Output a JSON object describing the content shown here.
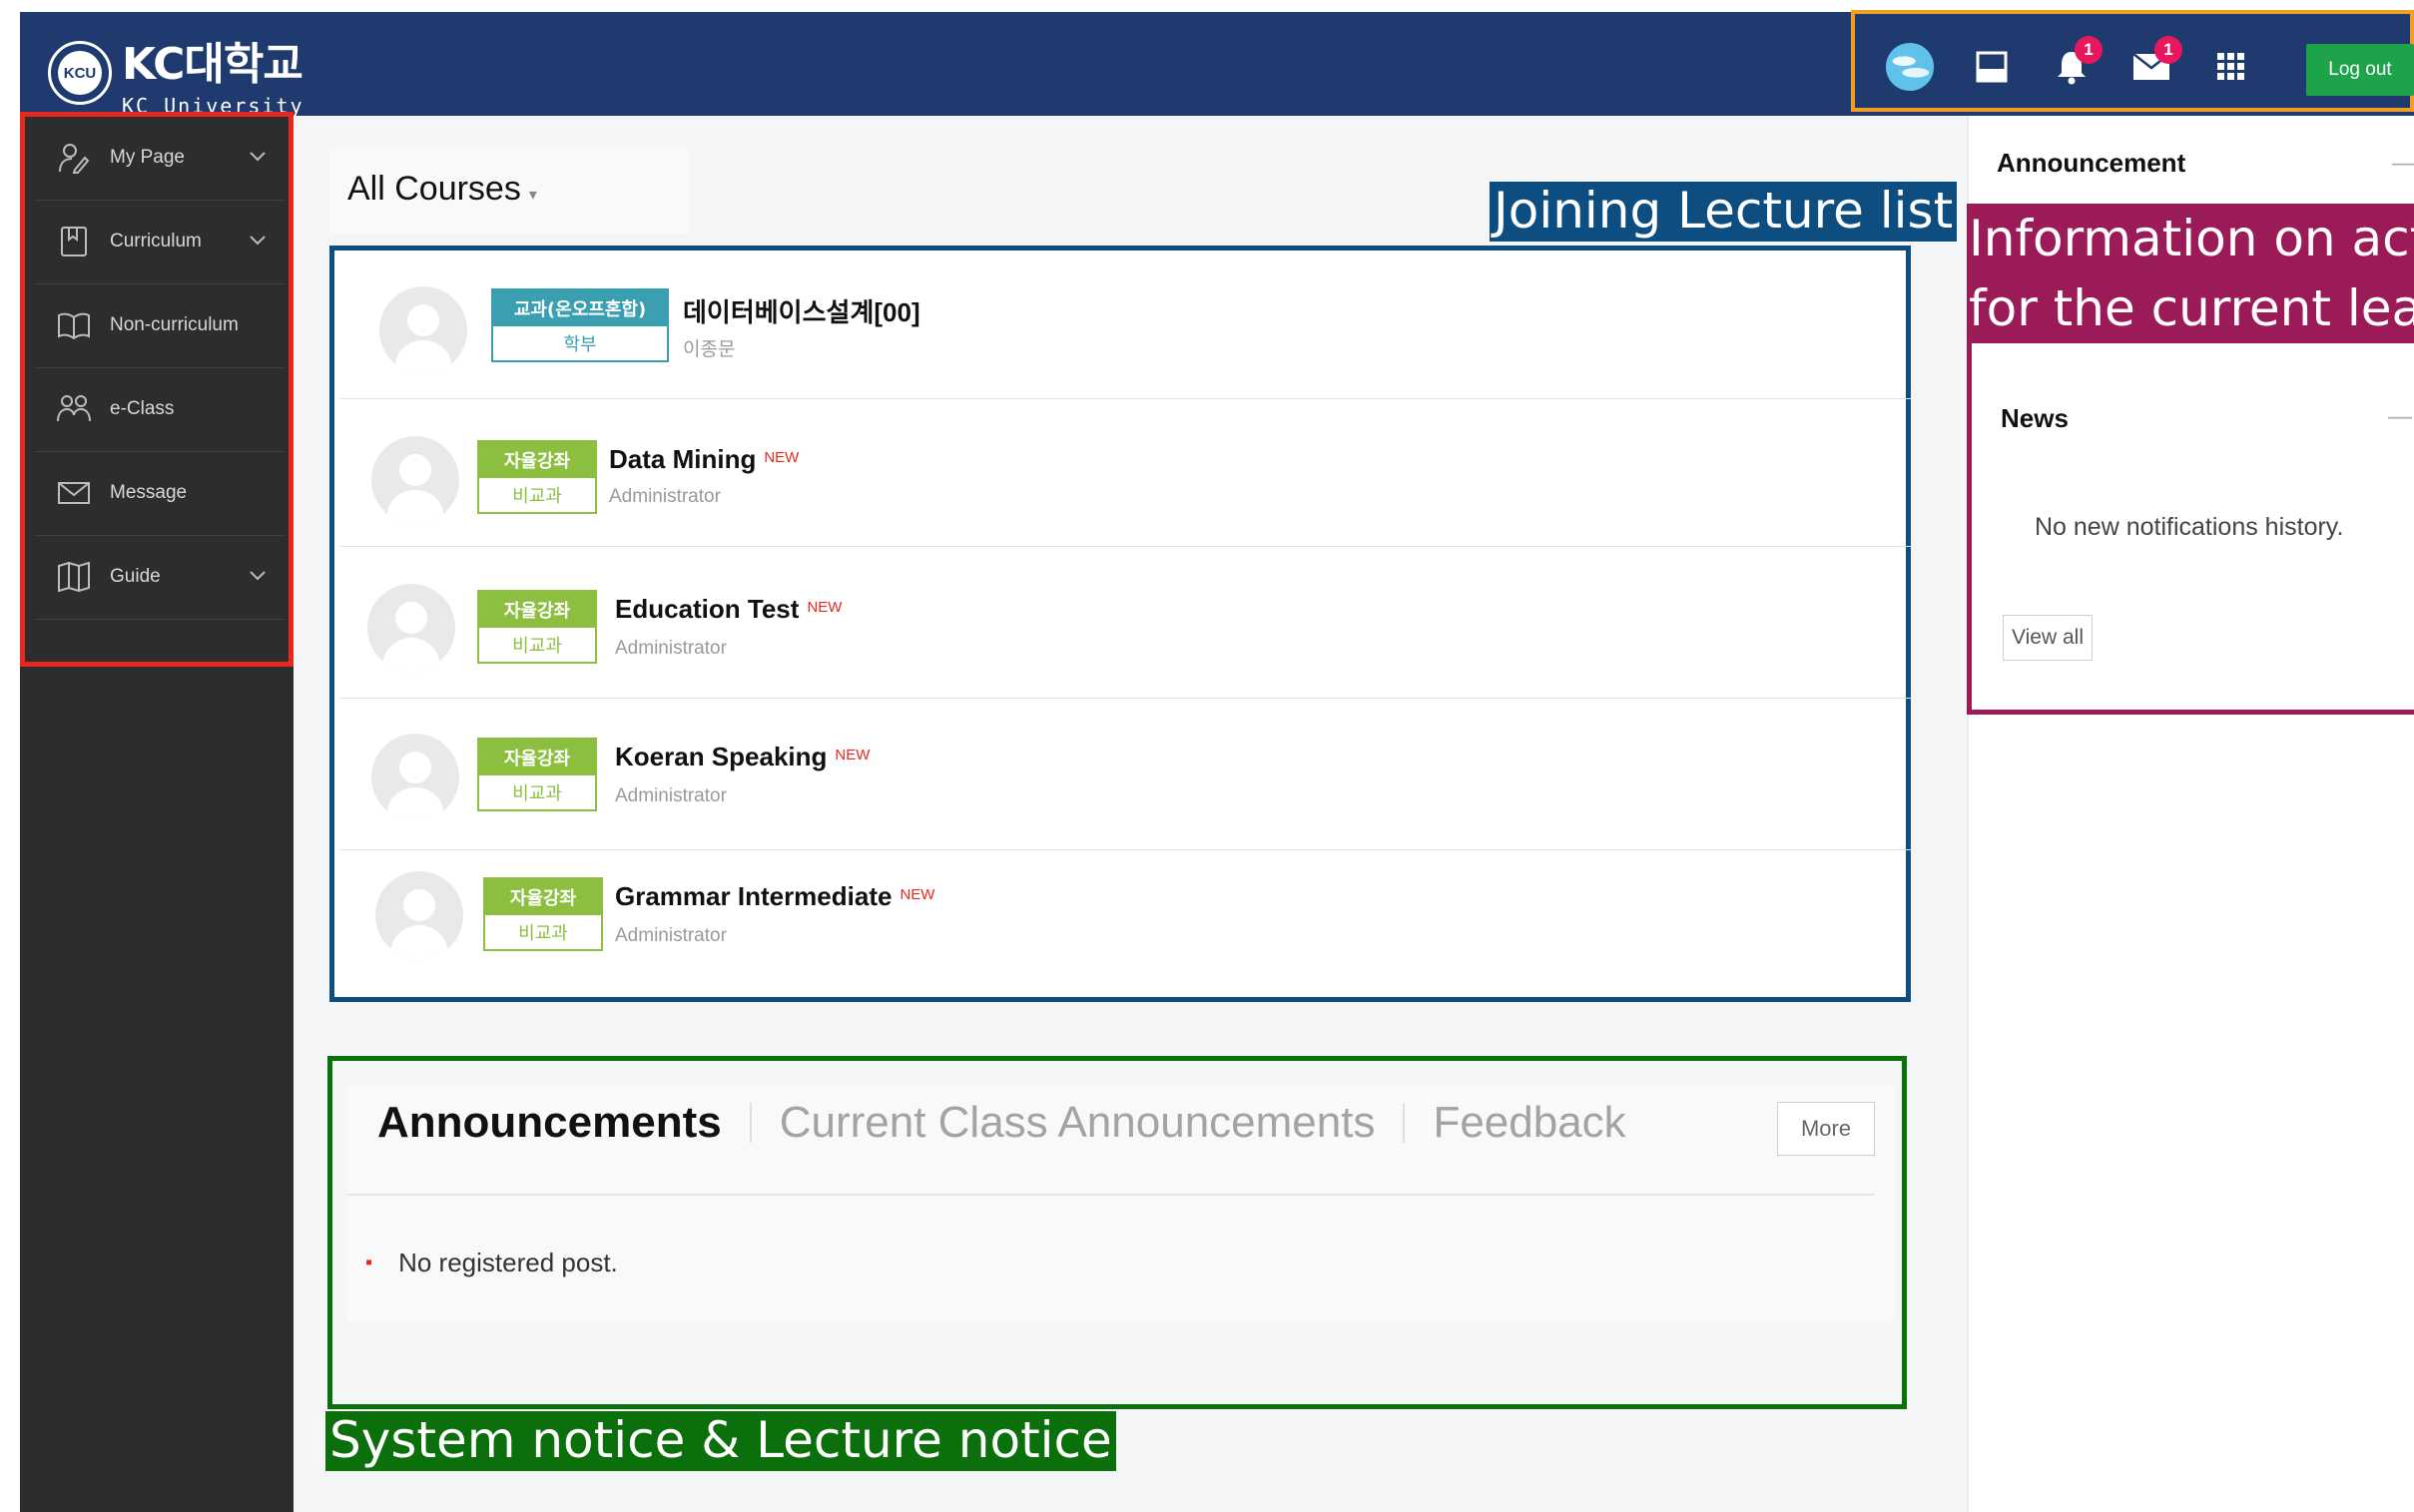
{
  "header": {
    "logo_ko": "KC대학교",
    "logo_en": "KC University",
    "logo_seal": "KCU",
    "notifications_badge": "1",
    "messages_badge": "1",
    "logout_label": "Log out",
    "colors": {
      "bar": "#1f3a6e",
      "frame": "#f0a020",
      "logout": "#1ea34a"
    }
  },
  "sidebar": {
    "items": [
      {
        "label": "My Page",
        "icon": "user-edit-icon",
        "has_submenu": true
      },
      {
        "label": "Curriculum",
        "icon": "book-icon",
        "has_submenu": true
      },
      {
        "label": "Non-curriculum",
        "icon": "open-book-icon",
        "has_submenu": false
      },
      {
        "label": "e-Class",
        "icon": "group-icon",
        "has_submenu": false
      },
      {
        "label": "Message",
        "icon": "envelope-icon",
        "has_submenu": false
      },
      {
        "label": "Guide",
        "icon": "map-icon",
        "has_submenu": true
      }
    ]
  },
  "courses": {
    "title": "All Courses",
    "items": [
      {
        "tag_top": "교과(온오프혼합)",
        "tag_bottom": "학부",
        "title": "데이터베이스설계[00]",
        "is_new": false,
        "instructor": "이종문"
      },
      {
        "tag_top": "자율강좌",
        "tag_bottom": "비교과",
        "title": "Data Mining",
        "is_new": true,
        "instructor": "Administrator"
      },
      {
        "tag_top": "자율강좌",
        "tag_bottom": "비교과",
        "title": "Education Test",
        "is_new": true,
        "instructor": "Administrator"
      },
      {
        "tag_top": "자율강좌",
        "tag_bottom": "비교과",
        "title": "Koeran Speaking",
        "is_new": true,
        "instructor": "Administrator"
      },
      {
        "tag_top": "자율강좌",
        "tag_bottom": "비교과",
        "title": "Grammar Intermediate",
        "is_new": true,
        "instructor": "Administrator"
      }
    ],
    "new_label": "NEW"
  },
  "notices": {
    "tabs": [
      "Announcements",
      "Current Class Announcements",
      "Feedback"
    ],
    "active_tab": "Announcements",
    "more_label": "More",
    "empty_text": "No registered post."
  },
  "right": {
    "announcement_title": "Announcement",
    "news_title": "News",
    "news_empty": "No new notifications history.",
    "view_all_label": "View all",
    "collapse_glyph": "—"
  },
  "captions": {
    "lecture_list": "Joining Lecture list",
    "notices": "System notice & Lecture notice",
    "info_line1": "Information on activiti",
    "info_line2": "for the current learnin",
    "colors": {
      "lecture": "#0d4d80",
      "notice": "#0b6f0b",
      "info": "#9a1b57",
      "sidebar_frame": "#e8281e"
    }
  }
}
